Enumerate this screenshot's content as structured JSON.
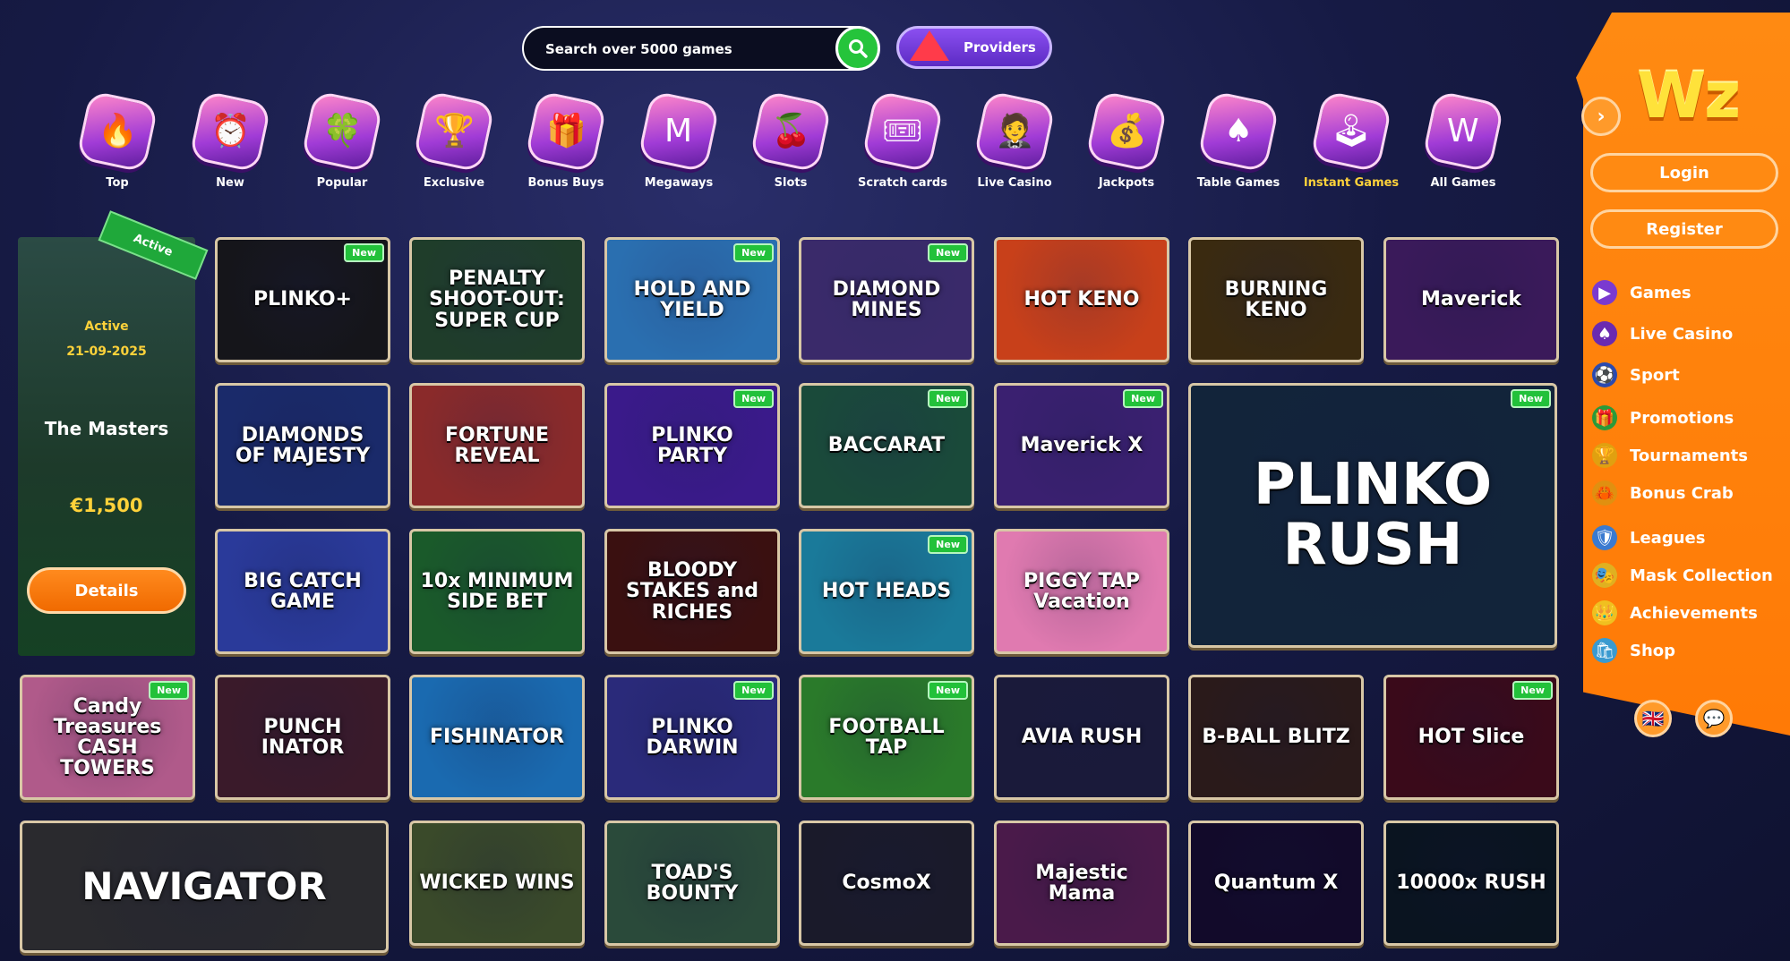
{
  "search": {
    "placeholder": "Search over 5000 games"
  },
  "providers": {
    "label": "Providers"
  },
  "categories": [
    {
      "label": "Top",
      "icon": "🔥"
    },
    {
      "label": "New",
      "icon": "⏰"
    },
    {
      "label": "Popular",
      "icon": "🍀"
    },
    {
      "label": "Exclusive",
      "icon": "🏆"
    },
    {
      "label": "Bonus Buys",
      "icon": "🎁"
    },
    {
      "label": "Megaways",
      "icon": "M"
    },
    {
      "label": "Slots",
      "icon": "🍒"
    },
    {
      "label": "Scratch cards",
      "icon": "🎟"
    },
    {
      "label": "Live Casino",
      "icon": "🤵"
    },
    {
      "label": "Jackpots",
      "icon": "💰"
    },
    {
      "label": "Table Games",
      "icon": "♠"
    },
    {
      "label": "Instant Games",
      "icon": "🕹"
    },
    {
      "label": "All Games",
      "icon": "W"
    }
  ],
  "tournament": {
    "ribbon": "Active",
    "status": "Active",
    "date": "21-09-2025",
    "name": "The Masters",
    "prize": "€1,500",
    "details_label": "Details"
  },
  "new_badge": "New",
  "games": [
    {
      "title": "PLINKO+",
      "new": true,
      "bg": "#15151a"
    },
    {
      "title": "PENALTY SHOOT-OUT: SUPER CUP",
      "new": false,
      "bg": "#1f3d2a"
    },
    {
      "title": "HOLD AND YIELD",
      "new": true,
      "bg": "#2a6fb0"
    },
    {
      "title": "DIAMOND MINES",
      "new": true,
      "bg": "#3a2a6a"
    },
    {
      "title": "HOT KENO",
      "new": false,
      "bg": "#c8401a"
    },
    {
      "title": "BURNING KENO",
      "new": false,
      "bg": "#3a2a10"
    },
    {
      "title": "Maverick",
      "new": false,
      "bg": "#3a1a5a"
    },
    {
      "title": "DIAMONDS OF MAJESTY",
      "new": false,
      "bg": "#1a2a6a"
    },
    {
      "title": "FORTUNE REVEAL",
      "new": false,
      "bg": "#8a2a2a"
    },
    {
      "title": "PLINKO PARTY",
      "new": true,
      "bg": "#3a1a8a"
    },
    {
      "title": "BACCARAT",
      "new": true,
      "bg": "#1a4a3a"
    },
    {
      "title": "Maverick X",
      "new": true,
      "bg": "#3a2070"
    },
    {
      "title": "BIG CATCH GAME",
      "new": false,
      "bg": "#2a3a9a"
    },
    {
      "title": "10x MINIMUM SIDE BET",
      "new": false,
      "bg": "#1a5a2a"
    },
    {
      "title": "BLOODY STAKES and RICHES",
      "new": false,
      "bg": "#3a1010"
    },
    {
      "title": "HOT HEADS",
      "new": true,
      "bg": "#1a7a9a"
    },
    {
      "title": "PIGGY TAP Vacation",
      "new": false,
      "bg": "#e07ab0"
    },
    {
      "title": "PLINKO RUSH",
      "new": true,
      "bg": "#12243a"
    },
    {
      "title": "Candy Treasures CASH TOWERS",
      "new": true,
      "bg": "#b05a8a"
    },
    {
      "title": "PUNCH INATOR",
      "new": false,
      "bg": "#3a1a2a"
    },
    {
      "title": "FISHINATOR",
      "new": false,
      "bg": "#1a6ab0"
    },
    {
      "title": "PLINKO DARWIN",
      "new": true,
      "bg": "#2a2a7a"
    },
    {
      "title": "FOOTBALL TAP",
      "new": true,
      "bg": "#2a7a2a"
    },
    {
      "title": "AVIA RUSH",
      "new": false,
      "bg": "#1a1a3a"
    },
    {
      "title": "B-BALL BLITZ",
      "new": false,
      "bg": "#2a1a1a"
    },
    {
      "title": "HOT Slice",
      "new": true,
      "bg": "#3a0a1a"
    },
    {
      "title": "NAVIGATOR",
      "new": false,
      "bg": "#2a2a2e"
    },
    {
      "title": "WICKED WINS",
      "new": false,
      "bg": "#3a4a2a"
    },
    {
      "title": "TOAD'S BOUNTY",
      "new": false,
      "bg": "#2a4a3a"
    },
    {
      "title": "CosmoX",
      "new": false,
      "bg": "#1a1a2a"
    },
    {
      "title": "Majestic Mama",
      "new": false,
      "bg": "#4a1a4a"
    },
    {
      "title": "Quantum X",
      "new": false,
      "bg": "#120a2a"
    },
    {
      "title": "10000x RUSH",
      "new": false,
      "bg": "#0a1420"
    }
  ],
  "sidebar": {
    "logo": "Wz",
    "login_label": "Login",
    "register_label": "Register",
    "menu": [
      {
        "label": "Games",
        "icon": "▶",
        "color": "#7a3ad0"
      },
      {
        "label": "Live Casino",
        "icon": "♠",
        "color": "#6a2ab0"
      },
      {
        "label": "Sport",
        "icon": "⚽",
        "color": "#2a4ab0"
      },
      {
        "label": "Promotions",
        "icon": "🎁",
        "color": "#2a9a3a"
      },
      {
        "label": "Tournaments",
        "icon": "🏆",
        "color": "#e0a010"
      },
      {
        "label": "Bonus Crab",
        "icon": "🦀",
        "color": "#e09010"
      },
      {
        "label": "Leagues",
        "icon": "🛡",
        "color": "#3a7ad0"
      },
      {
        "label": "Mask Collection",
        "icon": "🎭",
        "color": "#e0b020"
      },
      {
        "label": "Achievements",
        "icon": "👑",
        "color": "#f0c020"
      },
      {
        "label": "Shop",
        "icon": "🛍",
        "color": "#3a9ad0"
      }
    ]
  }
}
